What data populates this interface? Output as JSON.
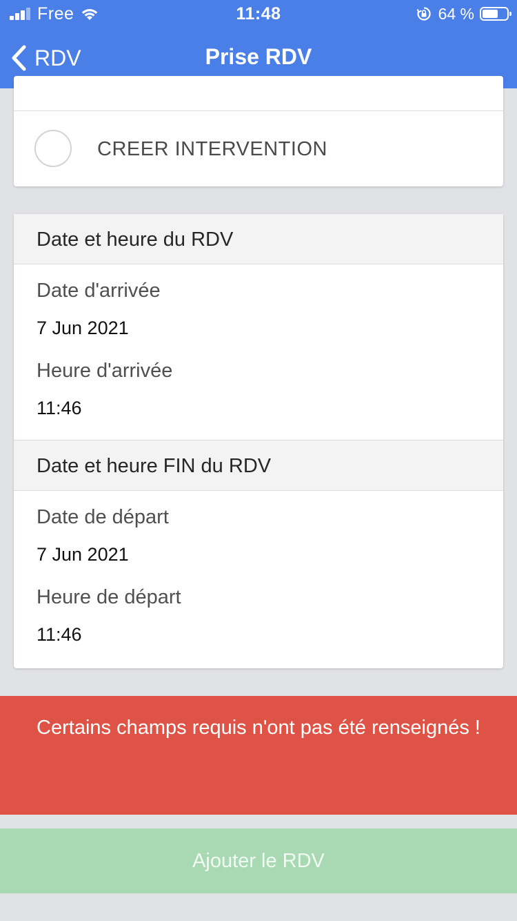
{
  "status_bar": {
    "carrier": "Free",
    "time": "11:48",
    "battery_percent_label": "64 %",
    "battery_level": 0.64,
    "icons": [
      "signal-icon",
      "wifi-icon",
      "rotation-lock-icon",
      "battery-icon"
    ]
  },
  "nav": {
    "back_label": "RDV",
    "title": "Prise RDV",
    "background_color": "#4a7fe8"
  },
  "options": {
    "create_intervention_label": "CREER INTERVENTION",
    "create_intervention_selected": false
  },
  "rdv_start": {
    "section_title": "Date et heure du RDV",
    "arrival_date_label": "Date d'arrivée",
    "arrival_date_value": "7 Jun 2021",
    "arrival_time_label": "Heure d'arrivée",
    "arrival_time_value": "11:46"
  },
  "rdv_end": {
    "section_title": "Date et heure FIN du RDV",
    "departure_date_label": "Date de départ",
    "departure_date_value": "7 Jun 2021",
    "departure_time_label": "Heure de départ",
    "departure_time_value": "11:46"
  },
  "error": {
    "message": "Certains champs requis n'ont pas été renseignés !",
    "color": "#de5345"
  },
  "actions": {
    "add_rdv_label": "Ajouter le RDV",
    "add_rdv_color": "#a8d9b3",
    "add_rdv_enabled": false
  }
}
